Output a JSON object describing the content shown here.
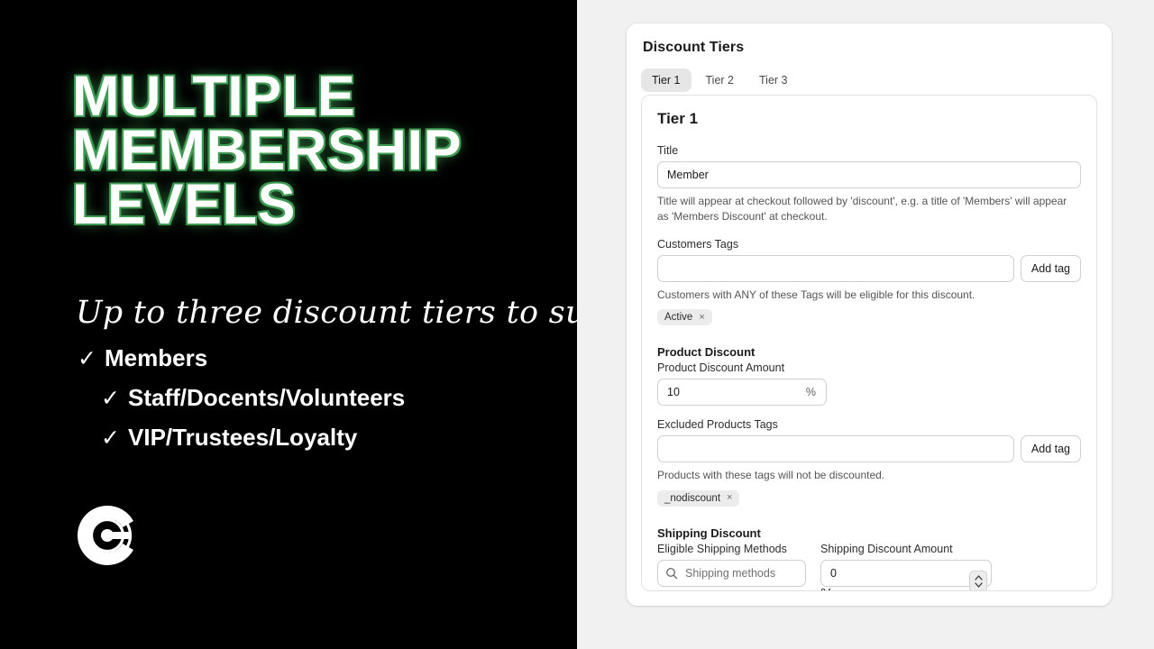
{
  "promo": {
    "headline_lines": [
      "MULTIPLE",
      "MEMBERSHIP",
      "LEVELS"
    ],
    "subtitle": "Up to three discount tiers to support",
    "checkmark": "✓",
    "features": [
      "Members",
      "Staff/Docents/Volunteers",
      "VIP/Trustees/Loyalty"
    ],
    "logo_name": "concentric-c-logo",
    "colors": {
      "background": "#000000",
      "text": "#ffffff",
      "accent_glow": "#3d9b52"
    }
  },
  "app": {
    "card": {
      "title": "Discount Tiers",
      "tabs": [
        {
          "label": "Tier 1",
          "active": true
        },
        {
          "label": "Tier 2",
          "active": false
        },
        {
          "label": "Tier 3",
          "active": false
        }
      ],
      "panel": {
        "heading": "Tier 1",
        "title_field": {
          "label": "Title",
          "value": "Member",
          "placeholder": "",
          "helper": "Title will appear at checkout followed by 'discount', e.g. a title of 'Members' will appear as 'Members Discount' at checkout."
        },
        "customers_tags": {
          "label": "Customers Tags",
          "value": "",
          "placeholder": "",
          "add_button": "Add tag",
          "helper": "Customers with ANY of these Tags will be eligible for this discount.",
          "tags": [
            "Active"
          ]
        },
        "product_discount": {
          "section_title": "Product Discount",
          "amount_label": "Product Discount Amount",
          "amount_value": "10",
          "amount_suffix": "%"
        },
        "excluded_products_tags": {
          "label": "Excluded Products Tags",
          "value": "",
          "placeholder": "",
          "add_button": "Add tag",
          "helper": "Products with these tags will not be discounted.",
          "tags": [
            "_nodiscount"
          ]
        },
        "shipping_discount": {
          "section_title": "Shipping Discount",
          "methods_label": "Eligible Shipping Methods",
          "methods_placeholder": "Shipping methods",
          "methods_value": "",
          "amount_label": "Shipping Discount Amount",
          "amount_value": "0",
          "amount_suffix": "%"
        },
        "chip_remove_glyph": "×"
      }
    },
    "colors": {
      "background": "#f1f1f1",
      "card": "#ffffff",
      "border": "#e1e1e1",
      "active_tab": "#e6e6e6",
      "chip": "#ececec"
    }
  }
}
